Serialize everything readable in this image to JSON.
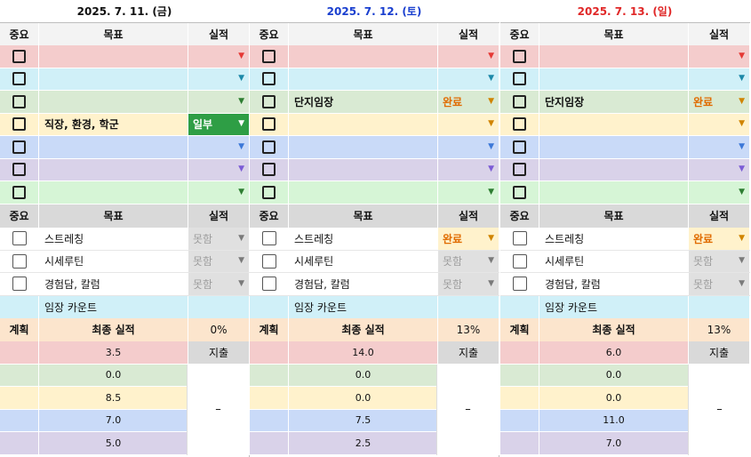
{
  "colors": {
    "pink": "#f4cccc",
    "cyan": "#d0f0f8",
    "green": "#d9ead3",
    "yellow": "#fff2cc",
    "blue": "#c9daf8",
    "purple": "#d9d2e9",
    "lime": "#d6f5d6",
    "header_grey": "#d9d9d9",
    "header_light": "#f3f3f3",
    "peach": "#fce5cd",
    "partial_green": "#2e9e45",
    "done_orange": "#e06b00",
    "arrow_red": "#e53935",
    "arrow_teal": "#1e88a8",
    "arrow_green": "#2e7d32",
    "arrow_orange": "#d08400",
    "arrow_blue": "#3c78d8",
    "arrow_purple": "#7b5cd6",
    "arrow_grey": "#7a7a7a"
  },
  "days": [
    {
      "date": "2025. 7. 11. (금)",
      "date_color": "#111111",
      "headers": {
        "importance": "중요",
        "goal": "목표",
        "result": "실적"
      },
      "goals": [
        {
          "goal": "",
          "status": "",
          "row_color": "pink",
          "arrow": "arrow_red"
        },
        {
          "goal": "",
          "status": "",
          "row_color": "cyan",
          "arrow": "arrow_teal"
        },
        {
          "goal": "",
          "status": "",
          "row_color": "green",
          "arrow": "arrow_green"
        },
        {
          "goal": "직장, 환경, 학군",
          "status": "일부",
          "status_type": "partial",
          "row_color": "yellow",
          "arrow": "arrow_orange"
        },
        {
          "goal": "",
          "status": "",
          "row_color": "blue",
          "arrow": "arrow_blue"
        },
        {
          "goal": "",
          "status": "",
          "row_color": "purple",
          "arrow": "arrow_purple"
        },
        {
          "goal": "",
          "status": "",
          "row_color": "lime",
          "arrow": "arrow_green"
        }
      ],
      "routine_headers": {
        "importance": "중요",
        "goal": "목표",
        "result": "실적"
      },
      "routines": [
        {
          "goal": "스트레칭",
          "status": "못함",
          "status_type": "none"
        },
        {
          "goal": "시세루틴",
          "status": "못함",
          "status_type": "none"
        },
        {
          "goal": "경험담, 칼럼",
          "status": "못함",
          "status_type": "none"
        }
      ],
      "count_label": "임장 카운트",
      "summary": {
        "plan": "계획",
        "final": "최종 실적",
        "percent": "0%"
      },
      "values": [
        "3.5",
        "0.0",
        "8.5",
        "7.0",
        "5.0"
      ],
      "expense_label": "지출",
      "expense_value": "–"
    },
    {
      "date": "2025. 7. 12. (토)",
      "date_color": "#1a3fcf",
      "headers": {
        "importance": "중요",
        "goal": "목표",
        "result": "실적"
      },
      "goals": [
        {
          "goal": "",
          "status": "",
          "row_color": "pink",
          "arrow": "arrow_red"
        },
        {
          "goal": "",
          "status": "",
          "row_color": "cyan",
          "arrow": "arrow_teal"
        },
        {
          "goal": "단지임장",
          "status": "완료",
          "status_type": "done",
          "row_color": "green",
          "arrow": "arrow_orange"
        },
        {
          "goal": "",
          "status": "",
          "row_color": "yellow",
          "arrow": "arrow_orange"
        },
        {
          "goal": "",
          "status": "",
          "row_color": "blue",
          "arrow": "arrow_blue"
        },
        {
          "goal": "",
          "status": "",
          "row_color": "purple",
          "arrow": "arrow_purple"
        },
        {
          "goal": "",
          "status": "",
          "row_color": "lime",
          "arrow": "arrow_green"
        }
      ],
      "routine_headers": {
        "importance": "중요",
        "goal": "목표",
        "result": "실적"
      },
      "routines": [
        {
          "goal": "스트레칭",
          "status": "완료",
          "status_type": "done"
        },
        {
          "goal": "시세루틴",
          "status": "못함",
          "status_type": "none"
        },
        {
          "goal": "경험담, 칼럼",
          "status": "못함",
          "status_type": "none"
        }
      ],
      "count_label": "임장 카운트",
      "summary": {
        "plan": "계획",
        "final": "최종 실적",
        "percent": "13%"
      },
      "values": [
        "14.0",
        "0.0",
        "0.0",
        "7.5",
        "2.5"
      ],
      "expense_label": "지출",
      "expense_value": "–"
    },
    {
      "date": "2025. 7. 13. (일)",
      "date_color": "#e02828",
      "headers": {
        "importance": "중요",
        "goal": "목표",
        "result": "실적"
      },
      "goals": [
        {
          "goal": "",
          "status": "",
          "row_color": "pink",
          "arrow": "arrow_red"
        },
        {
          "goal": "",
          "status": "",
          "row_color": "cyan",
          "arrow": "arrow_teal"
        },
        {
          "goal": "단지임장",
          "status": "완료",
          "status_type": "done",
          "row_color": "green",
          "arrow": "arrow_orange"
        },
        {
          "goal": "",
          "status": "",
          "row_color": "yellow",
          "arrow": "arrow_orange"
        },
        {
          "goal": "",
          "status": "",
          "row_color": "blue",
          "arrow": "arrow_blue"
        },
        {
          "goal": "",
          "status": "",
          "row_color": "purple",
          "arrow": "arrow_purple"
        },
        {
          "goal": "",
          "status": "",
          "row_color": "lime",
          "arrow": "arrow_green"
        }
      ],
      "routine_headers": {
        "importance": "중요",
        "goal": "목표",
        "result": "실적"
      },
      "routines": [
        {
          "goal": "스트레칭",
          "status": "완료",
          "status_type": "done"
        },
        {
          "goal": "시세루틴",
          "status": "못함",
          "status_type": "none"
        },
        {
          "goal": "경험담, 칼럼",
          "status": "못함",
          "status_type": "none"
        }
      ],
      "count_label": "임장 카운트",
      "summary": {
        "plan": "계획",
        "final": "최종 실적",
        "percent": "13%"
      },
      "values": [
        "6.0",
        "0.0",
        "0.0",
        "11.0",
        "7.0"
      ],
      "expense_label": "지출",
      "expense_value": "–"
    }
  ],
  "value_row_colors": [
    "pink",
    "green",
    "yellow",
    "blue",
    "purple"
  ],
  "icons": {
    "checkbox": "checkbox-icon",
    "dropdown": "dropdown-arrow-icon"
  }
}
